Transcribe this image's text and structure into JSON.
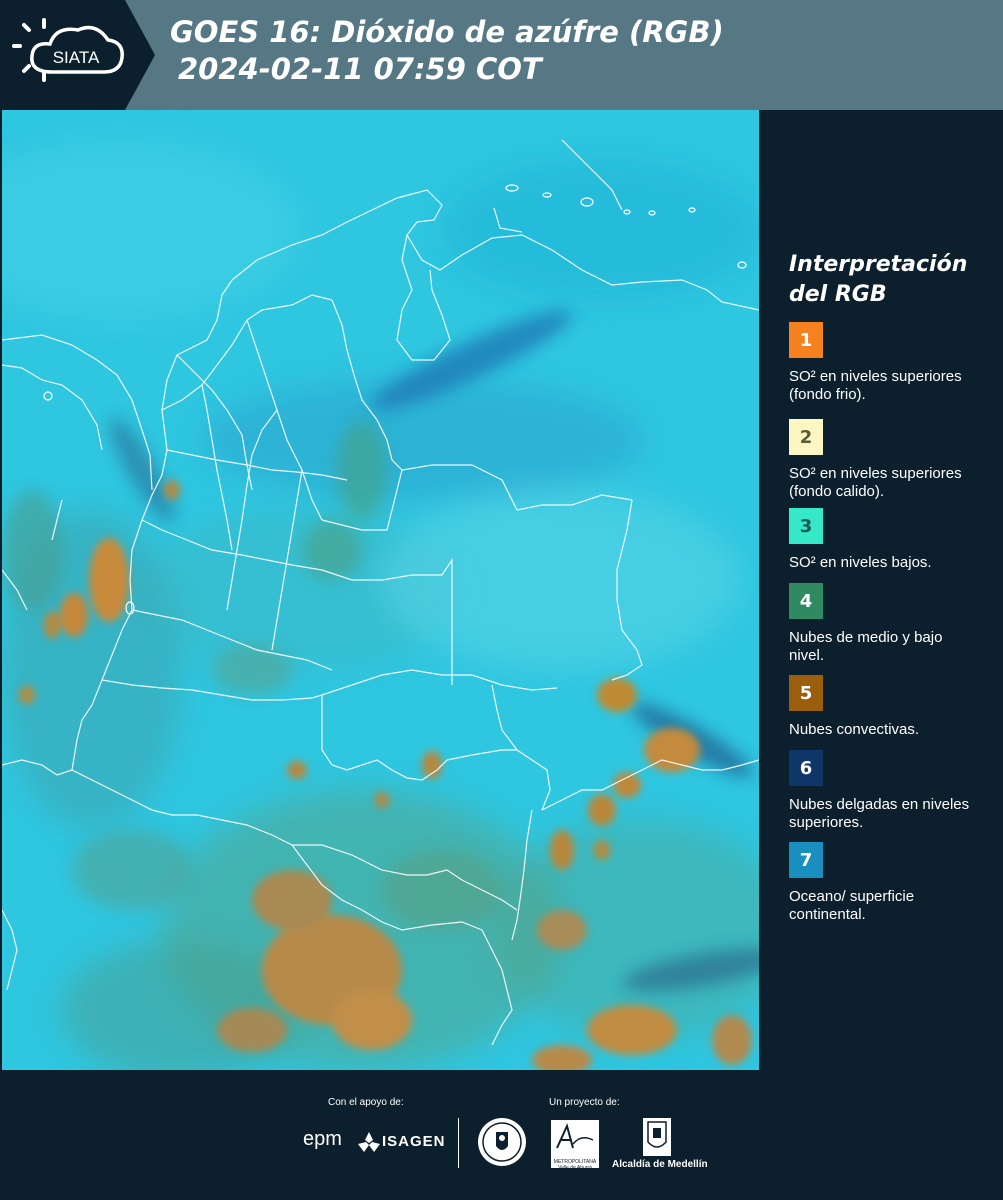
{
  "header": {
    "logo_text": "SIATA",
    "title_line1": "GOES 16: Dióxido de azúfre (RGB)",
    "title_line2": "2024-02-11 07:59 COT"
  },
  "legend": {
    "title_line1": "Interpretación",
    "title_line2": "del RGB",
    "items": [
      {
        "number": "1",
        "color": "#f5821f",
        "text_color": "#ffffff",
        "text": "SO² en niveles superiores (fondo frio)."
      },
      {
        "number": "2",
        "color": "#fdf6c3",
        "text_color": "#5a5a3a",
        "text": "SO² en niveles superiores (fondo calido)."
      },
      {
        "number": "3",
        "color": "#34e8c8",
        "text_color": "#1c5a56",
        "text": "SO² en niveles bajos."
      },
      {
        "number": "4",
        "color": "#2f8a62",
        "text_color": "#ffffff",
        "text": "Nubes de medio y bajo nivel."
      },
      {
        "number": "5",
        "color": "#9a5e0c",
        "text_color": "#ffffff",
        "text": "Nubes convectivas."
      },
      {
        "number": "6",
        "color": "#0f3668",
        "text_color": "#ffffff",
        "text": "Nubes delgadas en niveles superiores."
      },
      {
        "number": "7",
        "color": "#1a8fbf",
        "text_color": "#ffffff",
        "text": "Oceano/ superficie continental."
      }
    ]
  },
  "footer": {
    "support_label": "Con el apoyo de:",
    "project_label": "Un proyecto de:",
    "sponsors": [
      "epm",
      "ISAGEN"
    ],
    "partners": [
      "Área Metropolitana Valle de Aburrá",
      "Alcaldía de Medellín"
    ],
    "partner_caption_metro": "METROPOLITANA",
    "partner_caption_metro_sub": "Valle de Aburrá",
    "partner_caption_alcaldia": "Alcaldía de Medellín"
  },
  "colors": {
    "header_bg": "#557884",
    "panel_bg": "#0c1f2c",
    "map_base": "#2fc6e0"
  }
}
